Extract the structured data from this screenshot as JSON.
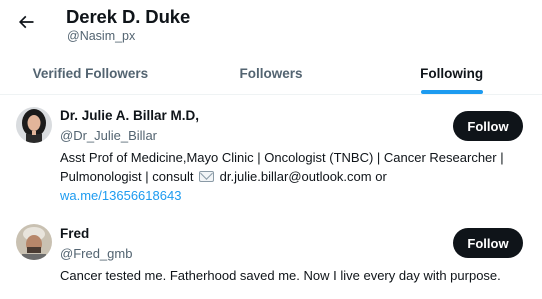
{
  "header": {
    "title": "Derek D. Duke",
    "handle": "@Nasim_px"
  },
  "tabs": [
    {
      "label": "Verified Followers",
      "active": false
    },
    {
      "label": "Followers",
      "active": false
    },
    {
      "label": "Following",
      "active": true
    }
  ],
  "users": [
    {
      "name": "Dr. Julie A. Billar M.D,",
      "handle": "@Dr_Julie_Billar",
      "bio_text_1": "Asst Prof of Medicine,Mayo Clinic | Oncologist (TNBC) | Cancer Researcher |",
      "bio_text_2a": "Pulmonologist | consult ",
      "bio_text_2b": " dr.julie.billar@outlook.com or",
      "bio_link": "wa.me/13656618643",
      "follow_label": "Follow"
    },
    {
      "name": "Fred",
      "handle": "@Fred_gmb",
      "bio_text_1": "Cancer tested me. Fatherhood saved me. Now I live every day with purpose.",
      "follow_label": "Follow"
    }
  ],
  "icons": {
    "back": "arrow-left-icon",
    "mail": "envelope-icon"
  },
  "colors": {
    "accent": "#1d9bf0",
    "button": "#0f1419",
    "secondary_text": "#536471"
  }
}
